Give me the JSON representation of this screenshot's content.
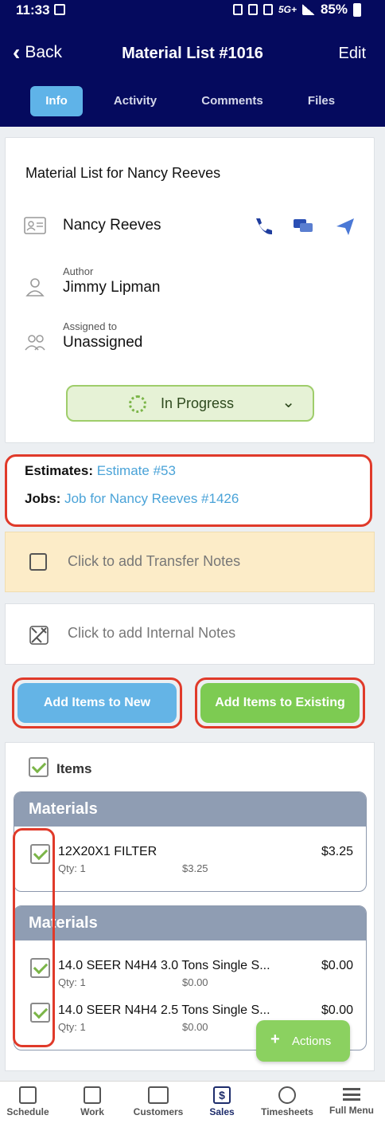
{
  "status_bar": {
    "time": "11:33",
    "network": "5G+",
    "battery": "85%"
  },
  "header": {
    "back_label": "Back",
    "title": "Material List #1016",
    "edit_label": "Edit"
  },
  "tabs": [
    {
      "label": "Info",
      "active": true
    },
    {
      "label": "Activity",
      "active": false
    },
    {
      "label": "Comments",
      "active": false
    },
    {
      "label": "Files",
      "active": false
    }
  ],
  "info": {
    "list_title": "Material List for Nancy Reeves",
    "customer_name": "Nancy Reeves",
    "author_label": "Author",
    "author_name": "Jimmy Lipman",
    "assigned_label": "Assigned to",
    "assigned_name": "Unassigned",
    "status": "In Progress"
  },
  "links": {
    "estimates_label": "Estimates:",
    "estimates_value": "Estimate #53",
    "jobs_label": "Jobs:",
    "jobs_value": "Job for Nancy Reeves #1426"
  },
  "notes": {
    "transfer_placeholder": "Click to add Transfer Notes",
    "internal_placeholder": "Click to add Internal Notes"
  },
  "actions": {
    "add_new_label": "Add Items to New",
    "add_existing_label": "Add Items to Existing"
  },
  "items": {
    "header_label": "Items",
    "groups": [
      {
        "title": "Materials",
        "lines": [
          {
            "name": "12X20X1 FILTER",
            "price": "$3.25",
            "qty": "Qty: 1",
            "amount": "$3.25"
          }
        ]
      },
      {
        "title": "Materials",
        "lines": [
          {
            "name": "14.0 SEER N4H4 3.0 Tons Single S...",
            "price": "$0.00",
            "qty": "Qty: 1",
            "amount": "$0.00"
          },
          {
            "name": "14.0 SEER N4H4 2.5 Tons Single S...",
            "price": "$0.00",
            "qty": "Qty: 1",
            "amount": "$0.00"
          }
        ]
      }
    ]
  },
  "fab": {
    "label": "Actions"
  },
  "bottom_nav": [
    {
      "label": "Schedule"
    },
    {
      "label": "Work"
    },
    {
      "label": "Customers"
    },
    {
      "label": "Sales",
      "active": true
    },
    {
      "label": "Timesheets"
    },
    {
      "label": "Full Menu"
    }
  ],
  "colors": {
    "header_bg": "#050a5e",
    "tab_active": "#5fb3e8",
    "link": "#4aa3d8",
    "status_bg": "#e6f2d6",
    "status_border": "#9fcd6b",
    "highlight": "#e03a2a",
    "add_new_btn": "#64b4e6",
    "add_existing_btn": "#7dcb52",
    "transfer_notes_bg": "#fcecc8",
    "group_header": "#8f9db3"
  }
}
